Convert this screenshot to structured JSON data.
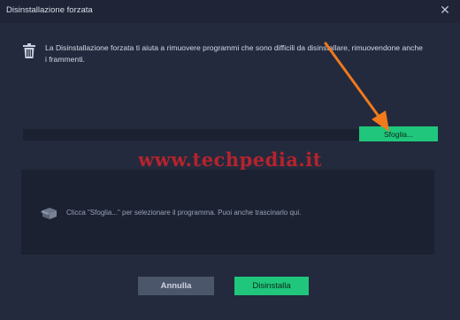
{
  "window": {
    "title": "Disinstallazione forzata",
    "close_glyph": "✕"
  },
  "info": {
    "icon": "trash-icon",
    "text": "La Disinstallazione forzata ti aiuta a rimuovere programmi che sono difficili da disinstallare, rimuovendone anche i frammenti."
  },
  "path_field": {
    "value": "",
    "placeholder": ""
  },
  "browse_button": {
    "label": "Sfoglia..."
  },
  "watermark": {
    "text": "www.techpedia.it"
  },
  "dropzone": {
    "icon": "box-icon",
    "text": "Clicca \"Sfoglia...\" per selezionare il programma. Puoi anche trascinarlo qui."
  },
  "buttons": {
    "cancel_label": "Annulla",
    "uninstall_label": "Disinstalla"
  },
  "colors": {
    "background": "#232a3d",
    "accent_green": "#1fc67b",
    "annotation_arrow": "#f07a1c",
    "watermark_red": "#b5232c"
  }
}
